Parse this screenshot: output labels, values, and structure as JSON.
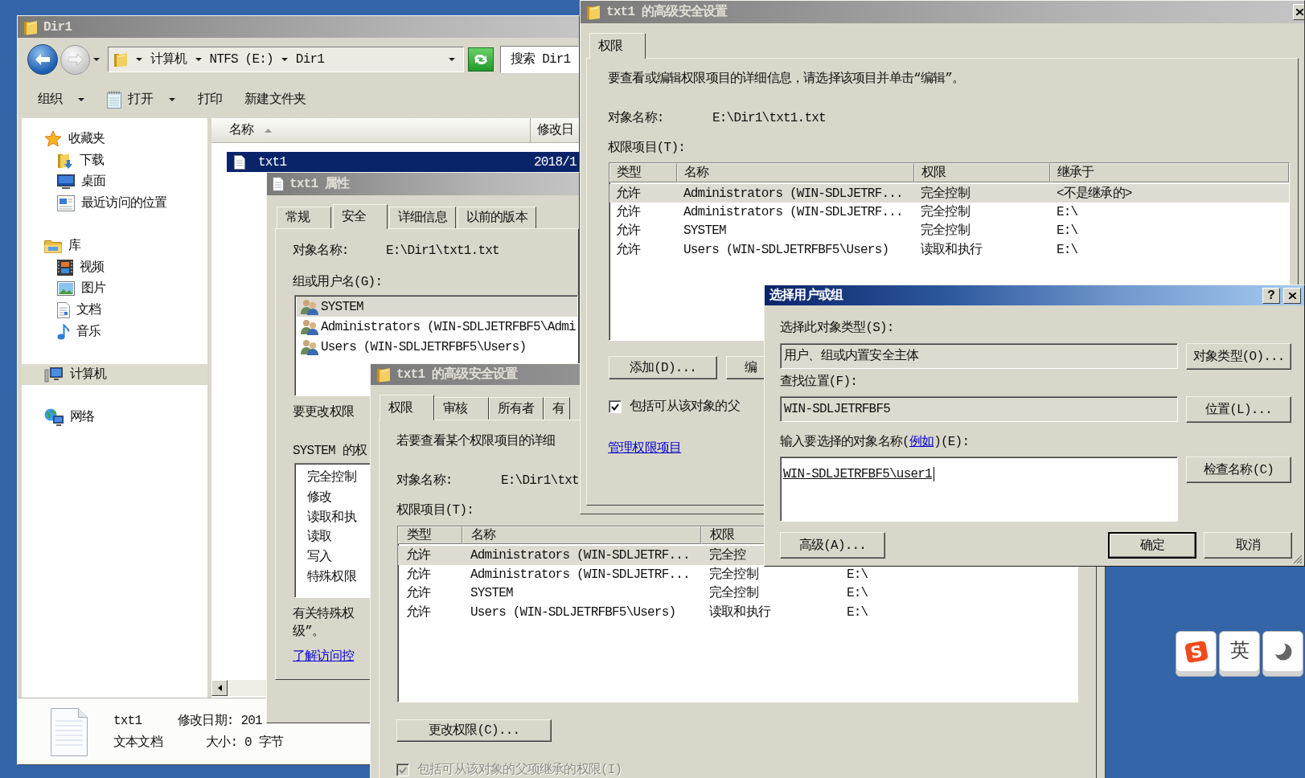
{
  "explorer": {
    "title": "Dir1",
    "breadcrumb": [
      "计算机",
      "NTFS (E:)",
      "Dir1"
    ],
    "search": {
      "placeholder": "搜索 Dir1"
    },
    "toolbar": [
      {
        "label": "组织",
        "kind": "plain",
        "dropdown": true
      },
      {
        "label": "打开",
        "kind": "app",
        "dropdown": true
      },
      {
        "label": "打印",
        "kind": "plain",
        "dropdown": false
      },
      {
        "label": "新建文件夹",
        "kind": "plain",
        "dropdown": false
      }
    ],
    "nav": [
      {
        "label": "收藏夹",
        "selected": false,
        "children": [
          {
            "label": "下载",
            "selected": false
          },
          {
            "label": "桌面",
            "selected": false
          },
          {
            "label": "最近访问的位置",
            "selected": false
          }
        ]
      },
      {
        "label": "库",
        "selected": false,
        "children": [
          {
            "label": "视频",
            "selected": false
          },
          {
            "label": "图片",
            "selected": false
          },
          {
            "label": "文档",
            "selected": false
          },
          {
            "label": "音乐",
            "selected": false
          }
        ]
      },
      {
        "label": "计算机",
        "selected": true
      },
      {
        "label": "网络",
        "selected": false
      }
    ],
    "columns": [
      {
        "label": "名称",
        "sorted": true
      },
      {
        "label": "修改日",
        "sorted": false
      }
    ],
    "files": [
      {
        "name": "txt1",
        "modified": "2018/1",
        "selected": true
      }
    ],
    "details": {
      "name": "txt1",
      "modified": "修改日期: 201",
      "type": "文本文档",
      "size": "大小: 0 字节"
    }
  },
  "properties": {
    "title": "txt1 属性",
    "tabs": [
      {
        "label": "常规",
        "selected": false
      },
      {
        "label": "安全",
        "selected": true
      },
      {
        "label": "详细信息",
        "selected": false
      },
      {
        "label": "以前的版本",
        "selected": false
      }
    ],
    "object_label": "对象名称:",
    "object_value": "E:\\Dir1\\txt1.txt",
    "groups_label": "组或用户名(G):",
    "groups": [
      {
        "name": "SYSTEM",
        "selected": true
      },
      {
        "name": "Administrators (WIN-SDLJETRFBF5\\Admi",
        "selected": false
      },
      {
        "name": "Users (WIN-SDLJETRFBF5\\Users)",
        "selected": false
      }
    ],
    "edit_hint": "要更改权限",
    "permissions_label": "SYSTEM 的权",
    "permissions": [
      "完全控制",
      "修改",
      "读取和执",
      "读取",
      "写入",
      "特殊权限"
    ],
    "advanced_hint": [
      "有关特殊权",
      "级”。"
    ],
    "link": "了解访问控"
  },
  "advanced_top": {
    "title": "txt1 的高级安全设置",
    "tabs": [
      {
        "label": "权限",
        "selected": true
      }
    ],
    "instructions": "要查看或编辑权限项目的详细信息，请选择该项目并单击“编辑”。",
    "object_label": "对象名称:",
    "object_value": "E:\\Dir1\\txt1.txt",
    "entries_label": "权限项目(T):",
    "columns": [
      "类型",
      "名称",
      "权限",
      "继承于"
    ],
    "rows": [
      {
        "cells": [
          "允许",
          "Administrators (WIN-SDLJETRF...",
          "完全控制",
          "<不是继承的>"
        ],
        "selected": true
      },
      {
        "cells": [
          "允许",
          "Administrators (WIN-SDLJETRF...",
          "完全控制",
          "E:\\"
        ],
        "selected": false
      },
      {
        "cells": [
          "允许",
          "SYSTEM",
          "完全控制",
          "E:\\"
        ],
        "selected": false
      },
      {
        "cells": [
          "允许",
          "Users (WIN-SDLJETRFBF5\\Users)",
          "读取和执行",
          "E:\\"
        ],
        "selected": false
      }
    ],
    "buttons": [
      "添加(D)...",
      "编"
    ],
    "inherit": {
      "label": "包括可从该对象的父",
      "checked": true,
      "disabled": false
    },
    "manage_link": "管理权限项目"
  },
  "advanced_inner": {
    "title": "txt1 的高级安全设置",
    "tabs": [
      {
        "label": "权限",
        "selected": true
      },
      {
        "label": "审核",
        "selected": false
      },
      {
        "label": "所有者",
        "selected": false
      },
      {
        "label": "有",
        "selected": false
      }
    ],
    "instructions": "若要查看某个权限项目的详细",
    "object_label": "对象名称:",
    "object_value": "E:\\Dir1\\txt",
    "entries_label": "权限项目(T):",
    "columns": [
      "类型",
      "名称",
      "权限"
    ],
    "rows": [
      {
        "cells": [
          "允许",
          "Administrators (WIN-SDLJETRF...",
          "完全控"
        ],
        "selected": true
      },
      {
        "cells": [
          "允许",
          "Administrators (WIN-SDLJETRF...",
          "完全控制",
          "E:\\"
        ],
        "selected": false
      },
      {
        "cells": [
          "允许",
          "SYSTEM",
          "完全控制",
          "E:\\"
        ],
        "selected": false
      },
      {
        "cells": [
          "允许",
          "Users (WIN-SDLJETRFBF5\\Users)",
          "读取和执行",
          "E:\\"
        ],
        "selected": false
      }
    ],
    "change_button": "更改权限(C)...",
    "inherit": {
      "label": "包括可从该对象的父项继承的权限(I)",
      "checked": true,
      "disabled": true
    }
  },
  "select_dialog": {
    "title": "选择用户或组",
    "help": "?",
    "fields": [
      {
        "label": "选择此对象类型(S):",
        "value": "用户、组或内置安全主体",
        "readonly": true,
        "button": "对象类型(O)..."
      },
      {
        "label": "查找位置(F):",
        "value": "WIN-SDLJETRFBF5",
        "readonly": true,
        "button": "位置(L)..."
      }
    ],
    "names": {
      "label_before": "输入要选择的对象名称(",
      "link": "例如",
      "label_after": ")(E):",
      "value": "WIN-SDLJETRFBF5\\user1",
      "button": "检查名称(C)"
    },
    "buttons": [
      {
        "label": "高级(A)...",
        "default": false
      },
      {
        "label": "确定",
        "default": true
      },
      {
        "label": "取消",
        "default": false
      }
    ]
  },
  "ime_bar": {
    "keys": [
      {
        "kind": "logo",
        "label": "S"
      },
      {
        "kind": "text",
        "label": "英"
      },
      {
        "kind": "moon"
      }
    ]
  }
}
